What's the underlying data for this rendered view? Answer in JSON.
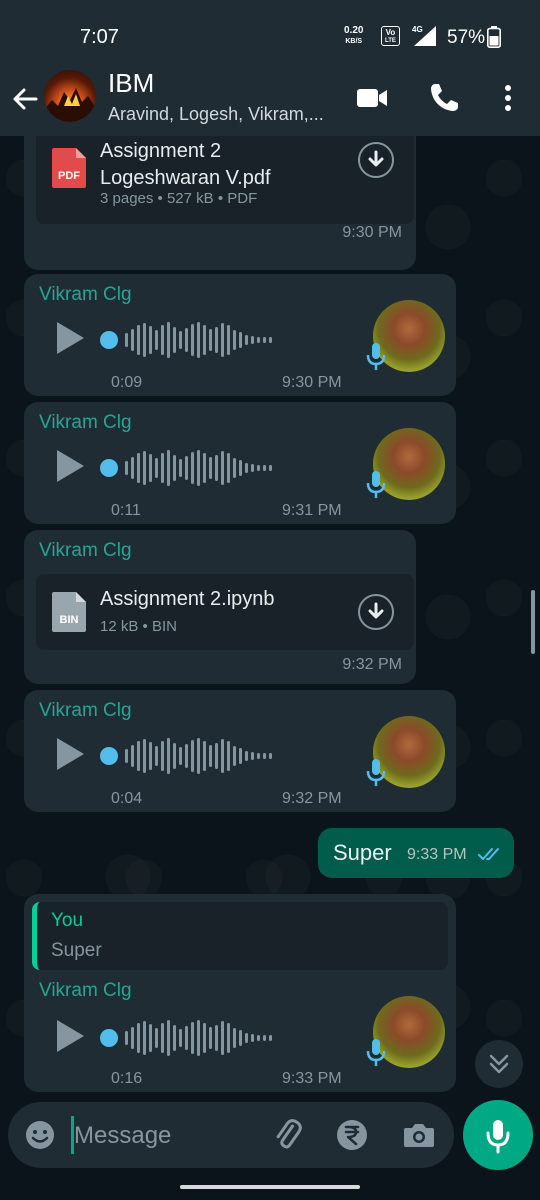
{
  "status_bar": {
    "time": "7:07",
    "speed_value": "0.20",
    "speed_unit": "KB/S",
    "volte_top": "Vo",
    "volte_bottom": "LTE",
    "network": "4G",
    "battery": "57%",
    "icons": [
      "volte-icon",
      "signal-icon",
      "battery-icon"
    ]
  },
  "header": {
    "title": "IBM",
    "subtitle": "Aravind, Logesh, Vikram,...",
    "icons": [
      "back-arrow-icon",
      "video-call-icon",
      "phone-icon",
      "more-vert-icon"
    ]
  },
  "messages": [
    {
      "type": "document",
      "file_icon": "PDF",
      "file_name_line1": "Assignment 2",
      "file_name_line2": "Logeshwaran V.pdf",
      "meta": "3 pages • 527 kB • PDF",
      "time": "9:30 PM"
    },
    {
      "type": "voice",
      "sender": "Vikram Clg",
      "duration": "0:09",
      "time": "9:30 PM"
    },
    {
      "type": "voice",
      "sender": "Vikram Clg",
      "duration": "0:11",
      "time": "9:31 PM"
    },
    {
      "type": "document",
      "sender": "Vikram Clg",
      "file_icon": "BIN",
      "file_name": "Assignment 2.ipynb",
      "meta": "12 kB • BIN",
      "time": "9:32 PM"
    },
    {
      "type": "voice",
      "sender": "Vikram Clg",
      "duration": "0:04",
      "time": "9:32 PM"
    },
    {
      "type": "outgoing_text",
      "text": "Super",
      "time": "9:33 PM",
      "status": "read"
    },
    {
      "type": "voice_reply",
      "reply_author": "You",
      "reply_text": "Super",
      "sender": "Vikram Clg",
      "duration": "0:16",
      "time": "9:33 PM"
    }
  ],
  "composer": {
    "placeholder": "Message",
    "icons": [
      "emoji-icon",
      "attach-icon",
      "rupee-icon",
      "camera-icon",
      "mic-icon"
    ]
  },
  "colors": {
    "background": "#0b141a",
    "header": "#1f2c34",
    "incoming_bubble": "#1f2c34",
    "outgoing_bubble": "#005c4b",
    "accent": "#00a884",
    "sender_name": "#22a894",
    "audio_dot": "#53bdeb"
  }
}
